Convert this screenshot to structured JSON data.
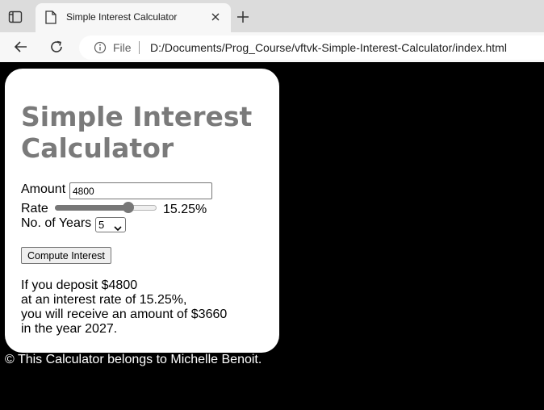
{
  "browser": {
    "tab_title": "Simple Interest Calculator",
    "new_tab_symbol": "+",
    "close_symbol": "×",
    "address_scheme_label": "File",
    "url": "D:/Documents/Prog_Course/vftvk-Simple-Interest-Calculator/index.html",
    "icons": [
      "tab-actions-icon",
      "page-icon",
      "close-icon",
      "plus-icon",
      "back-arrow-icon",
      "reload-icon",
      "info-icon"
    ]
  },
  "calculator": {
    "title": "Simple Interest Calculator",
    "amount_label": "Amount",
    "amount_value": "4800",
    "rate_label": "Rate",
    "rate_value": "15.25%",
    "rate_fraction": 0.61,
    "years_label": "No. of Years",
    "years_value": "5",
    "compute_label": "Compute Interest",
    "result_lines": [
      "If you deposit $4800",
      "at an interest rate of 15.25%,",
      "you will receive an amount of $3660",
      "in the year 2027."
    ]
  },
  "footer": {
    "text": "© This Calculator belongs to Michelle Benoit."
  },
  "colors": {
    "page_background": "#000000",
    "card_background": "#ffffff",
    "title_color": "#7a7a7a",
    "footer_text": "#ffffff"
  }
}
